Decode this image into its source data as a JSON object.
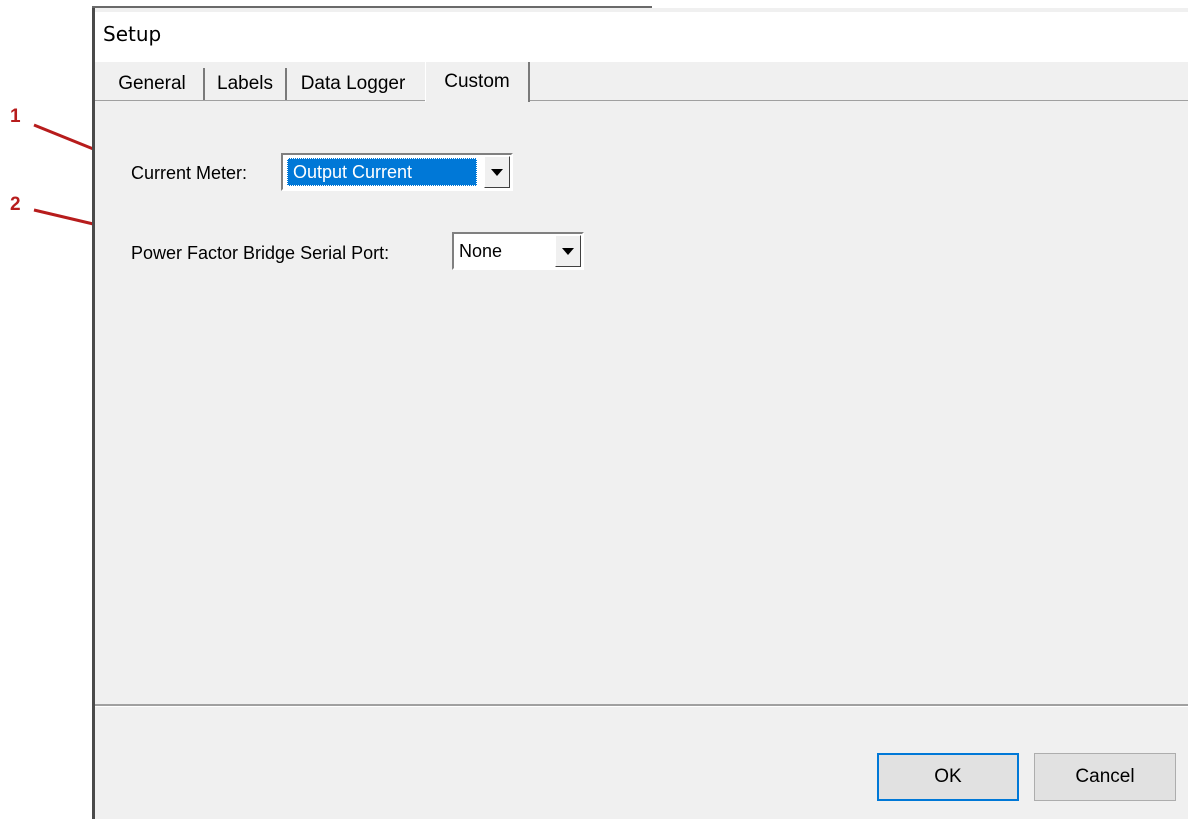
{
  "window": {
    "title": "Setup"
  },
  "tabs": [
    {
      "label": "General",
      "active": false
    },
    {
      "label": "Labels",
      "active": false
    },
    {
      "label": "Data Logger",
      "active": false
    },
    {
      "label": "Custom",
      "active": true
    }
  ],
  "fields": {
    "current_meter": {
      "label": "Current Meter:",
      "value": "Output Current"
    },
    "pf_bridge_port": {
      "label": "Power Factor Bridge Serial Port:",
      "value": "None"
    }
  },
  "buttons": {
    "ok": "OK",
    "cancel": "Cancel"
  },
  "annotations": {
    "one": "1",
    "two": "2"
  },
  "colors": {
    "annotation": "#b71c1c",
    "selection": "#0078d7",
    "dialog_bg": "#f0f0f0"
  }
}
